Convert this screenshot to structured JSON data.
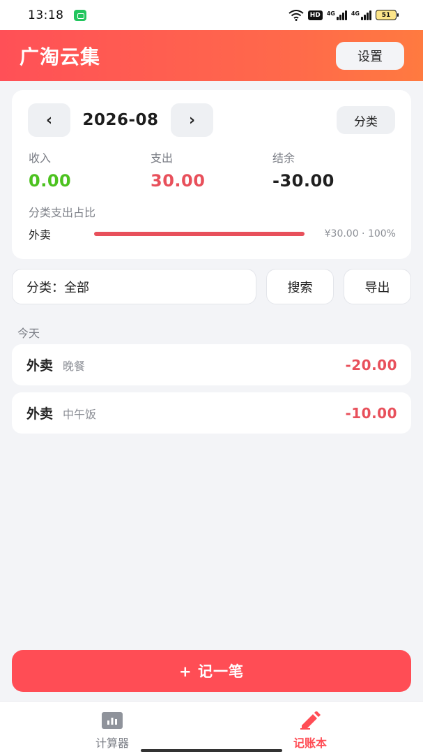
{
  "status_bar": {
    "time": "13:18",
    "hd_badge": "HD",
    "signal_1_label": "4G",
    "signal_2_label": "4G",
    "battery": "51"
  },
  "header": {
    "title": "广淘云集",
    "settings_label": "设置"
  },
  "summary": {
    "prev_label": "‹",
    "next_label": "›",
    "month": "2026-08",
    "category_label": "分类",
    "income_label": "收入",
    "income_value": "0.00",
    "expense_label": "支出",
    "expense_value": "30.00",
    "balance_label": "结余",
    "balance_value": "-30.00",
    "ratio_title": "分类支出占比",
    "ratio_items": [
      {
        "name": "外卖",
        "fraction": 1.0,
        "info": "¥30.00 · 100%"
      }
    ]
  },
  "filter": {
    "category_select": "分类：全部",
    "search_label": "搜索",
    "export_label": "导出"
  },
  "day_label": "今天",
  "records": [
    {
      "category": "外卖",
      "note": "晚餐",
      "amount": "-20.00"
    },
    {
      "category": "外卖",
      "note": "中午饭",
      "amount": "-10.00"
    }
  ],
  "add_button_label": "+ 记一笔",
  "bottom_nav": {
    "calc_label": "计算器",
    "book_label": "记账本"
  },
  "colors": {
    "accent": "#ff4d55",
    "income": "#4cc21f",
    "expense": "#e8505b"
  }
}
